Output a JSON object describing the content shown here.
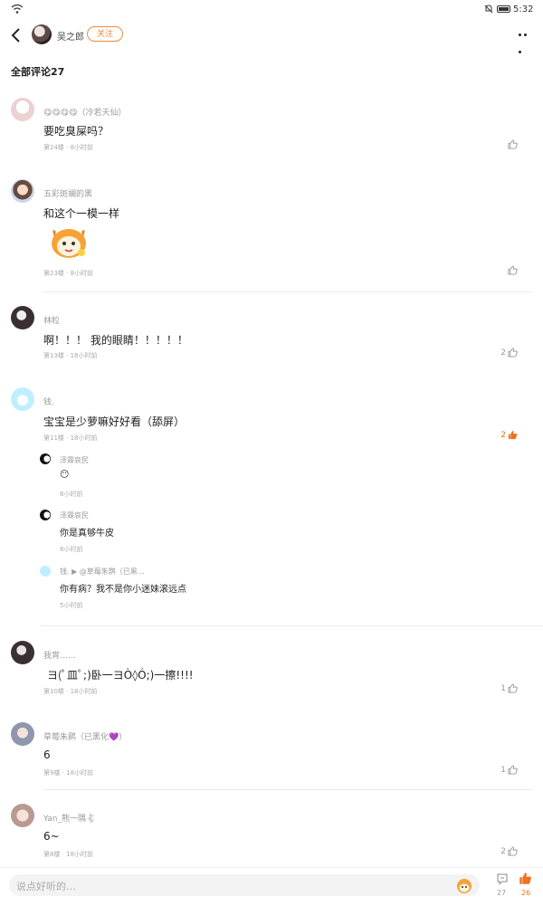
{
  "status_bar": {
    "time": "5:32"
  },
  "header": {
    "author_name": "吴之郎",
    "follow_label": "关注"
  },
  "section_title": "全部评论27",
  "comments": [
    {
      "name": "😋😋😋😋（冷若天仙）",
      "text": "要吃臭屎吗？",
      "meta": "第24楼 · 8小时前",
      "likes": "",
      "avatar_color": "#f0dede"
    },
    {
      "name": "五彩斑斓的黑",
      "text": "和这个一模一样",
      "meta": "第23楼 · 8小时前",
      "likes": "",
      "avatar_color": "#c9a58f"
    },
    {
      "name": "林粒",
      "text": "啊！！！ 我的眼睛！！！！！",
      "meta": "第13楼 · 18小时前",
      "likes": "2",
      "avatar_color": "#3a2f33"
    },
    {
      "name": "钱.",
      "text": "宝宝是少萝嘛好好看（舔屏）",
      "meta": "第11楼 · 18小时前",
      "likes": "2",
      "avatar_color": "#bfefff"
    },
    {
      "name": "我宵……",
      "text": "ヨ(ﾟ皿ﾟ;)卧一ヨÒ◊Ó;)一擦!!!!",
      "meta": "第10楼 · 18小时前",
      "likes": "1",
      "avatar_color": "#3a2f33"
    },
    {
      "name": "草莓朱鹮（已黑化💜）",
      "text": "6",
      "meta": "第9楼 · 18小时前",
      "likes": "1",
      "avatar_color": "#9aa5bd"
    },
    {
      "name": "Yan_熊一隅🐇",
      "text": "6~",
      "meta": "第8楼 · 18小时前",
      "likes": "2",
      "avatar_color": "#d3b7b0"
    }
  ],
  "replies": [
    {
      "name": "泽霖哀民",
      "text": "😶",
      "meta": "8小时前"
    },
    {
      "name": "泽霖哀民",
      "text": "你是真够牛皮",
      "meta": "8小时前"
    },
    {
      "name": "钱. ▶ @草莓朱鹮（已黑…",
      "text": "你有病？我不是你小迷妹滚远点",
      "meta": "5小时前"
    }
  ],
  "bottom_bar": {
    "placeholder": "说点好听的…",
    "comment_count": "27",
    "like_count": "26"
  },
  "colors": {
    "accent": "#f07020"
  }
}
